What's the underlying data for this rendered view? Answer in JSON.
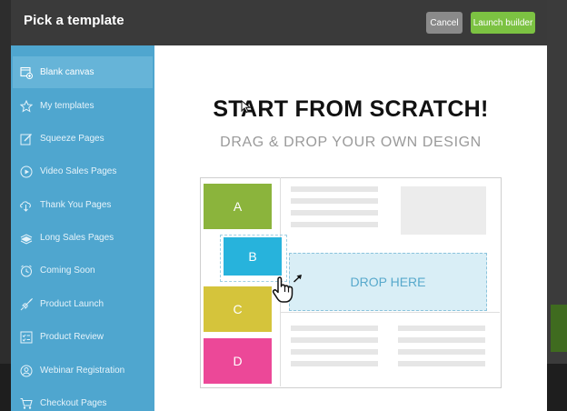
{
  "header": {
    "title": "Pick a template",
    "cancel_label": "Cancel",
    "launch_label": "Launch builder"
  },
  "sidebar": {
    "items": [
      {
        "label": "Blank canvas",
        "icon": "blank-canvas-icon",
        "active": true
      },
      {
        "label": "My templates",
        "icon": "star-icon"
      },
      {
        "label": "Squeeze Pages",
        "icon": "edit-icon"
      },
      {
        "label": "Video Sales Pages",
        "icon": "play-icon"
      },
      {
        "label": "Thank You Pages",
        "icon": "cloud-download-icon"
      },
      {
        "label": "Long Sales Pages",
        "icon": "stack-icon"
      },
      {
        "label": "Coming Soon",
        "icon": "clock-icon"
      },
      {
        "label": "Product Launch",
        "icon": "rocket-icon"
      },
      {
        "label": "Product Review",
        "icon": "checklist-icon"
      },
      {
        "label": "Webinar Registration",
        "icon": "webinar-icon"
      },
      {
        "label": "Checkout Pages",
        "icon": "cart-icon"
      }
    ]
  },
  "preview": {
    "headline": "START FROM SCRATCH!",
    "subheadline": "DRAG & DROP YOUR OWN DESIGN",
    "blocks": [
      "A",
      "B",
      "C",
      "D"
    ],
    "drop_label": "DROP HERE"
  },
  "colors": {
    "sidebar": "#4fa6cf",
    "launch_button": "#7cc242",
    "block_a": "#8bb43c",
    "block_b": "#27b3dc",
    "block_c": "#d5c43b",
    "block_d": "#ec4898"
  }
}
